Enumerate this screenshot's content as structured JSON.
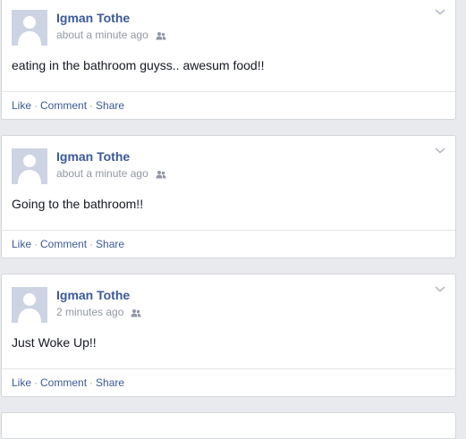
{
  "posts": [
    {
      "author": "Igman Tothe",
      "time": "about a minute ago",
      "text": "eating in the bathroom guyss.. awesum food!!",
      "actions": {
        "like": "Like",
        "comment": "Comment",
        "share": "Share"
      }
    },
    {
      "author": "Igman Tothe",
      "time": "about a minute ago",
      "text": "Going to the bathroom!!",
      "actions": {
        "like": "Like",
        "comment": "Comment",
        "share": "Share"
      }
    },
    {
      "author": "Igman Tothe",
      "time": "2 minutes ago",
      "text": "Just Woke Up!!",
      "actions": {
        "like": "Like",
        "comment": "Comment",
        "share": "Share"
      }
    }
  ],
  "separator": "·",
  "icons": {
    "audience": "friends-audience-icon",
    "menu": "chevron-down-icon",
    "avatar": "default-profile-silhouette"
  },
  "colors": {
    "link": "#3b5998",
    "meta": "#9197a3",
    "text": "#141823",
    "background": "#e9eaed"
  }
}
